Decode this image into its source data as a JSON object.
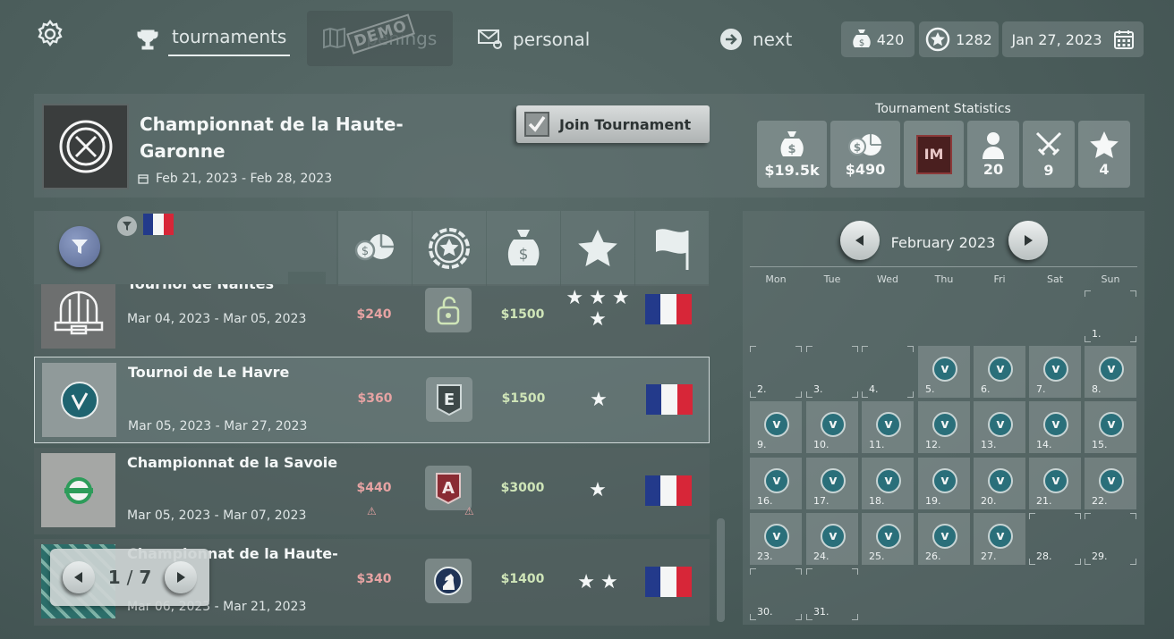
{
  "nav": {
    "tournaments": "tournaments",
    "openings": "openings",
    "demo": "DEMO",
    "personal": "personal",
    "next": "next"
  },
  "wallet": {
    "money": "420",
    "rating": "1282",
    "date": "Jan 27, 2023"
  },
  "featured": {
    "title": "Championnat de la Haute-Garonne",
    "dates": "Feb 21, 2023 - Feb 28, 2023",
    "join_label": "Join Tournament"
  },
  "stats": {
    "title": "Tournament Statistics",
    "prize_pool": "$19.5k",
    "entry_fee": "$490",
    "title_badge": "IM",
    "players": "20",
    "rounds": "9",
    "stars": "4"
  },
  "tournaments": [
    {
      "name": "Tournoi de Nantes",
      "dates": "Mar 04, 2023 - Mar 05, 2023",
      "fee": "$240",
      "prize": "$1500",
      "stars": 4,
      "badge": "unlock",
      "warning": false,
      "selected": false
    },
    {
      "name": "Tournoi de Le Havre",
      "dates": "Mar 05, 2023 - Mar 27, 2023",
      "fee": "$360",
      "prize": "$1500",
      "stars": 1,
      "badge": "E",
      "warning": false,
      "selected": true
    },
    {
      "name": "Championnat de la Savoie",
      "dates": "Mar 05, 2023 - Mar 07, 2023",
      "fee": "$440",
      "prize": "$3000",
      "stars": 1,
      "badge": "A",
      "warning": true,
      "selected": false
    },
    {
      "name": "Championnat de la Haute-",
      "dates": "Mar 06, 2023 - Mar 21, 2023",
      "fee": "$340",
      "prize": "$1400",
      "stars": 2,
      "badge": "knight",
      "warning": false,
      "selected": false
    }
  ],
  "pager": {
    "current": "1",
    "sep": "/",
    "total": "7"
  },
  "calendar": {
    "month": "February 2023",
    "weekdays": [
      "Mon",
      "Tue",
      "Wed",
      "Thu",
      "Fri",
      "Sat",
      "Sun"
    ],
    "days": [
      "1.",
      "2.",
      "3.",
      "4.",
      "5.",
      "6.",
      "7.",
      "8.",
      "9.",
      "10.",
      "11.",
      "12.",
      "13.",
      "14.",
      "15.",
      "16.",
      "17.",
      "18.",
      "19.",
      "20.",
      "21.",
      "22.",
      "23.",
      "24.",
      "25.",
      "26.",
      "27.",
      "28.",
      "29.",
      "30.",
      "31."
    ],
    "event_days": [
      5,
      6,
      7,
      8,
      9,
      10,
      11,
      12,
      13,
      14,
      15,
      16,
      17,
      18,
      19,
      20,
      21,
      22,
      23,
      24,
      25,
      26,
      27
    ],
    "event_icon": "v"
  },
  "colors": {
    "fee": "#e7a3a3",
    "prize": "#cfe5b8",
    "accent": "#2a6f7a"
  }
}
